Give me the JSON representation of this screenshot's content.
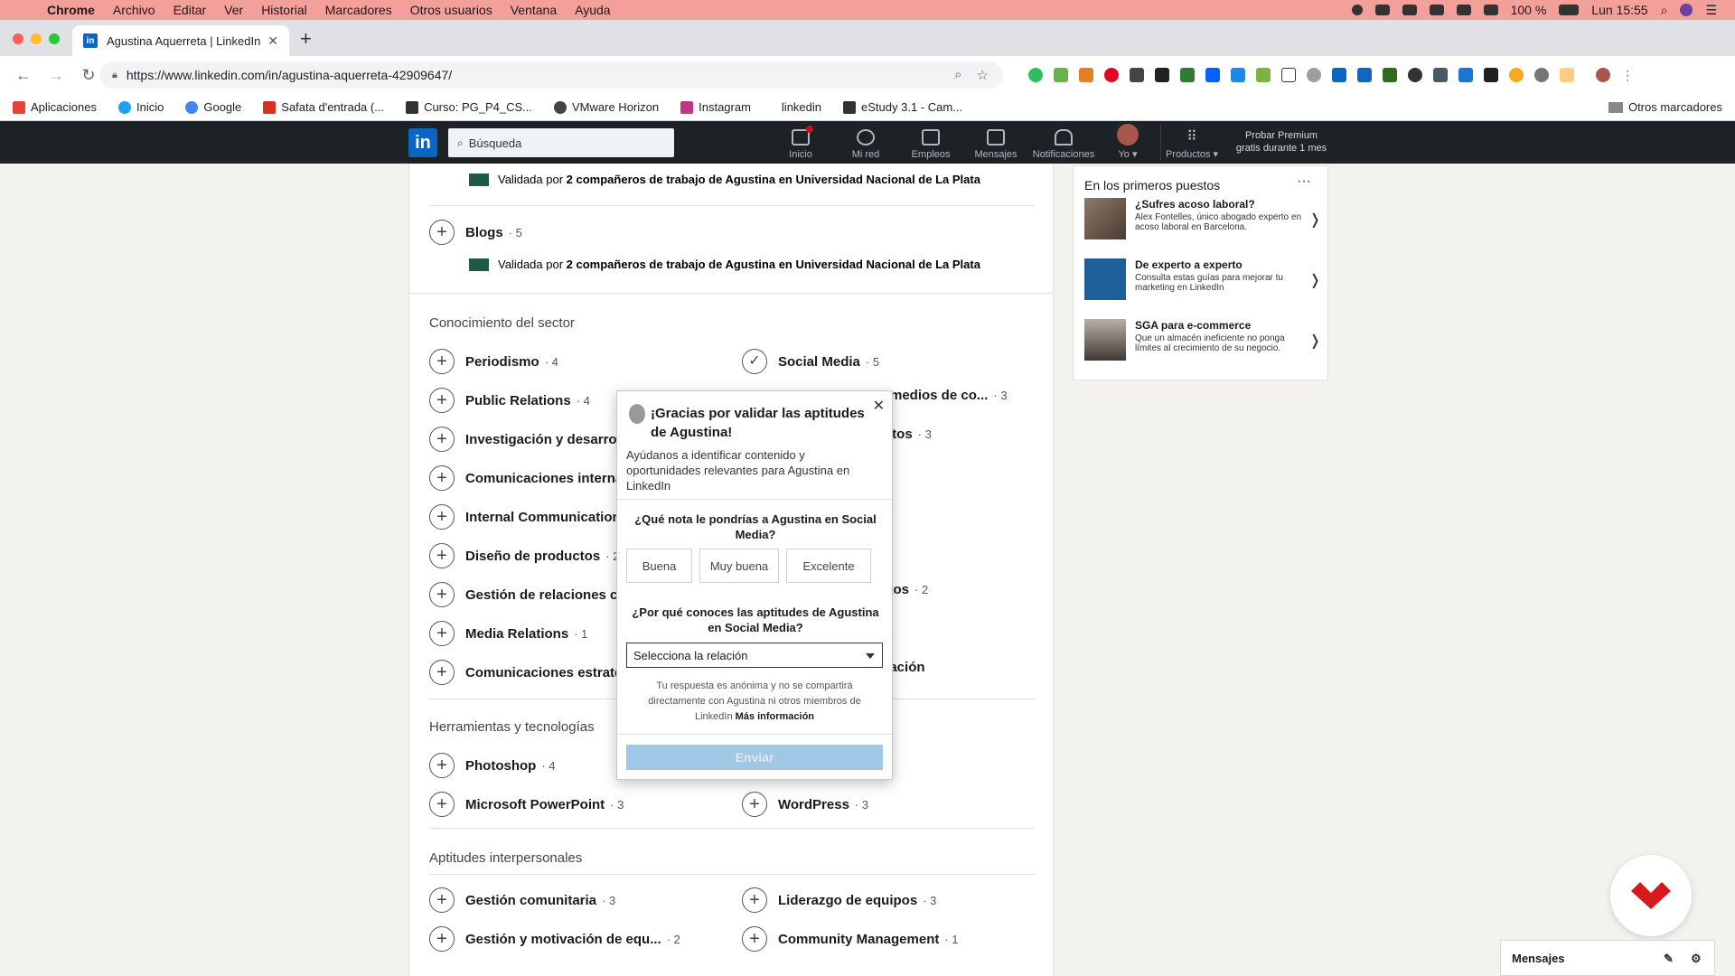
{
  "mac_menubar": {
    "app": "Chrome",
    "items": [
      "Archivo",
      "Editar",
      "Ver",
      "Historial",
      "Marcadores",
      "Otros usuarios",
      "Ventana",
      "Ayuda"
    ],
    "battery": "100 %",
    "clock": "Lun 15:55"
  },
  "browser": {
    "tab_title": "Agustina Aquerreta | LinkedIn",
    "url": "https://www.linkedin.com/in/agustina-aquerreta-42909647/",
    "bookmarks": [
      "Aplicaciones",
      "Inicio",
      "Google",
      "Safata d'entrada (...",
      "Curso: PG_P4_CS...",
      "VMware Horizon",
      "Instagram",
      "linkedin",
      "eStudy 3.1 - Cam..."
    ],
    "other_bookmarks": "Otros marcadores"
  },
  "linkedin_header": {
    "logo": "in",
    "search_placeholder": "Búsqueda",
    "nav": [
      "Inicio",
      "Mi red",
      "Empleos",
      "Mensajes",
      "Notificaciones",
      "Yo ▾",
      "Productos ▾"
    ],
    "premium_line1": "Probar Premium",
    "premium_line2": "gratis durante 1 mes"
  },
  "main": {
    "validated_prefix": "Validada por",
    "validated_detail": "2 compañeros de trabajo de Agustina en Universidad Nacional de La Plata",
    "blogs": {
      "name": "Blogs",
      "count": "· 5"
    },
    "sector_title": "Conocimiento del sector",
    "sector_left": [
      {
        "name": "Periodismo",
        "count": "· 4"
      },
      {
        "name": "Public Relations",
        "count": "· 4"
      },
      {
        "name": "Investigación y desarroll",
        "count": ""
      },
      {
        "name": "Comunicaciones interna",
        "count": ""
      },
      {
        "name": "Internal Communications",
        "count": ""
      },
      {
        "name": "Diseño de productos",
        "count": "· 2"
      },
      {
        "name": "Gestión de relaciones co",
        "count": ""
      },
      {
        "name": "Media Relations",
        "count": "· 1"
      },
      {
        "name": "Comunicaciones estraté",
        "count": ""
      }
    ],
    "sector_right": [
      {
        "name": "Social Media",
        "count": "· 5"
      },
      {
        "name": "medios de co...",
        "count": "· 3"
      },
      {
        "name": "ntos",
        "count": "· 3"
      },
      {
        "name": "uctos",
        "count": "· 2"
      },
      {
        "name": "cación",
        "count": ""
      }
    ],
    "tools_title": "Herramientas y tecnologías",
    "tools_left": [
      {
        "name": "Photoshop",
        "count": "· 4"
      },
      {
        "name": "Microsoft PowerPoint",
        "count": "· 3"
      }
    ],
    "tools_right": [
      {
        "name": "WordPress",
        "count": "· 3"
      }
    ],
    "soft_title": "Aptitudes interpersonales",
    "soft_left": [
      {
        "name": "Gestión comunitaria",
        "count": "· 3"
      },
      {
        "name": "Gestión y motivación de equ...",
        "count": "· 2"
      }
    ],
    "soft_right": [
      {
        "name": "Liderazgo de equipos",
        "count": "· 3"
      },
      {
        "name": "Community Management",
        "count": "· 1"
      }
    ]
  },
  "sidebar": {
    "title": "En los primeros puestos",
    "more": "···",
    "ads": [
      {
        "title": "¿Sufres acoso laboral?",
        "desc": "Alex Fontelles, único abogado experto en acoso laboral en Barcelona."
      },
      {
        "title": "De experto a experto",
        "desc": "Consulta estas guías para mejorar tu marketing en LinkedIn"
      },
      {
        "title": "SGA para e-commerce",
        "desc": "Que un almacén ineficiente no ponga límites al crecimiento de su negocio."
      }
    ]
  },
  "modal": {
    "title": "¡Gracias por validar las aptitudes de Agustina!",
    "subtitle": "Ayúdanos a identificar contenido y oportunidades relevantes para Agustina en LinkedIn",
    "question1": "¿Qué nota le pondrías a Agustina en Social Media?",
    "ratings": [
      "Buena",
      "Muy buena",
      "Excelente"
    ],
    "question2": "¿Por qué conoces las aptitudes de Agustina en Social Media?",
    "select_value": "Selecciona la relación",
    "note": "Tu respuesta es anónima y no se compartirá directamente con Agustina ni otros miembros de LinkedIn",
    "note_link": "Más información",
    "submit": "Enviar"
  },
  "messaging": {
    "label": "Mensajes"
  }
}
